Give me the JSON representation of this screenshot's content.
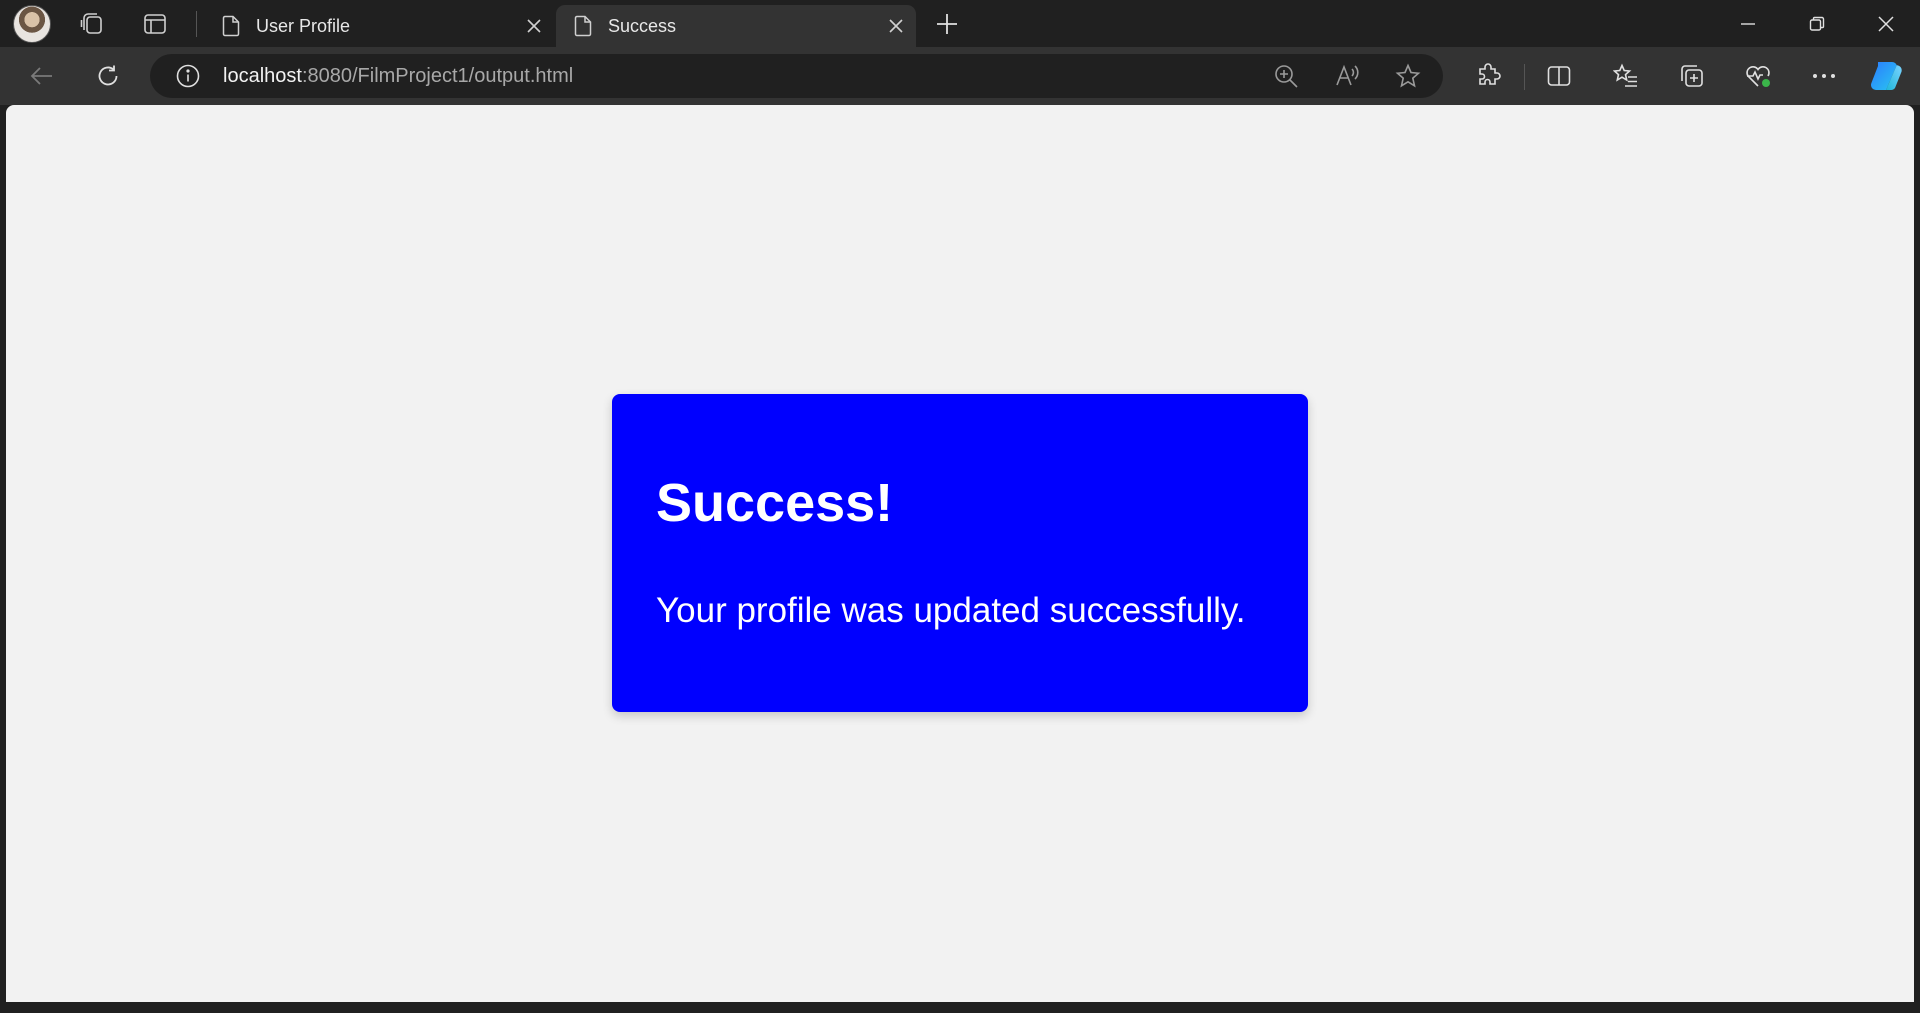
{
  "browser": {
    "tabs": [
      {
        "label": "User Profile",
        "active": false
      },
      {
        "label": "Success",
        "active": true
      }
    ],
    "address": {
      "host": "localhost",
      "path": ":8080/FilmProject1/output.html"
    }
  },
  "page": {
    "title": "Success!",
    "message": "Your profile was updated successfully.",
    "box_color": "#0000ff",
    "background_color": "#f2f2f2"
  },
  "icons": {
    "profile": "avatar",
    "workspaces": "workspaces-icon",
    "tab_actions": "tab-actions-icon",
    "back": "back-arrow-icon",
    "refresh": "refresh-icon",
    "site_info": "info-icon",
    "zoom": "zoom-in-icon",
    "read_aloud": "read-aloud-icon",
    "favorite": "star-icon",
    "extensions": "puzzle-icon",
    "split_screen": "split-screen-icon",
    "favorites": "favorites-list-icon",
    "collections": "collections-icon",
    "browser_essentials": "heart-pulse-icon",
    "more": "more-icon",
    "copilot": "copilot-icon"
  }
}
